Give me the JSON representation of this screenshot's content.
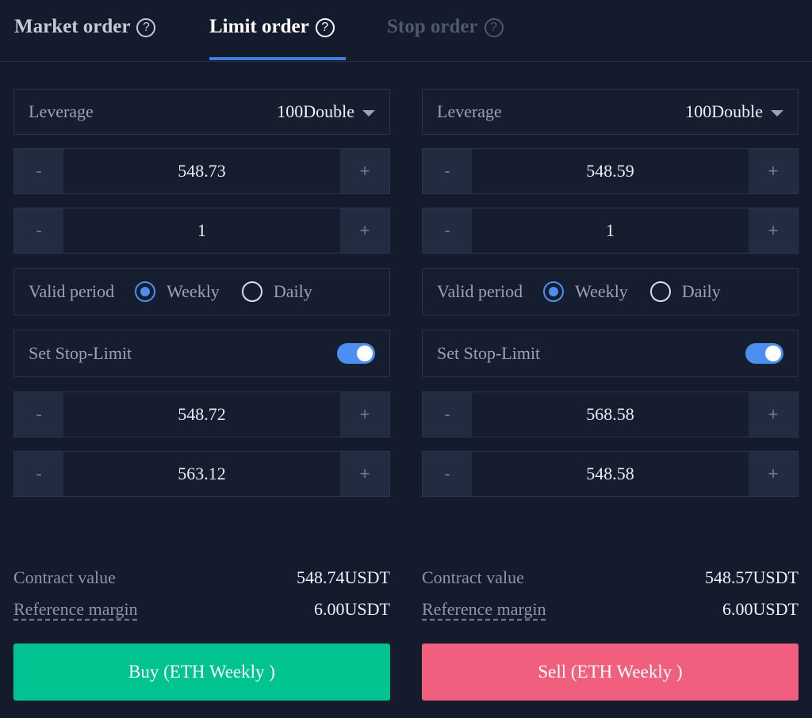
{
  "tabs": [
    {
      "label": "Market order",
      "active": false
    },
    {
      "label": "Limit order",
      "active": true
    },
    {
      "label": "Stop order",
      "active": false
    }
  ],
  "colors": {
    "accent": "#3d7fe0",
    "buy": "#00c38f",
    "sell": "#f0607e",
    "background": "#141b2c"
  },
  "buy": {
    "leverage_label": "Leverage",
    "leverage_value": "100Double",
    "price": "548.73",
    "quantity": "1",
    "valid_period_label": "Valid period",
    "period_options": [
      "Weekly",
      "Daily"
    ],
    "period_selected": "Weekly",
    "stop_limit_label": "Set Stop-Limit",
    "stop_limit_enabled": true,
    "stop_price": "548.72",
    "limit_price": "563.12",
    "contract_value_label": "Contract value",
    "contract_value": "548.74USDT",
    "reference_margin_label": "Reference margin",
    "reference_margin": "6.00USDT",
    "button_label": "Buy (ETH Weekly )",
    "minus": "-",
    "plus": "+"
  },
  "sell": {
    "leverage_label": "Leverage",
    "leverage_value": "100Double",
    "price": "548.59",
    "quantity": "1",
    "valid_period_label": "Valid period",
    "period_options": [
      "Weekly",
      "Daily"
    ],
    "period_selected": "Weekly",
    "stop_limit_label": "Set Stop-Limit",
    "stop_limit_enabled": true,
    "stop_price": "568.58",
    "limit_price": "548.58",
    "contract_value_label": "Contract value",
    "contract_value": "548.57USDT",
    "reference_margin_label": "Reference margin",
    "reference_margin": "6.00USDT",
    "button_label": "Sell (ETH Weekly )",
    "minus": "-",
    "plus": "+"
  }
}
